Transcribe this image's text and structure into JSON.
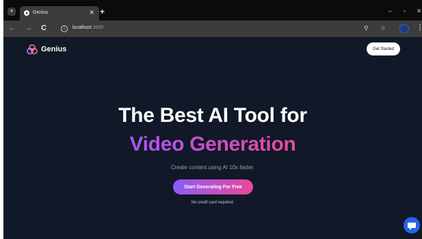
{
  "browser": {
    "tab_search_glyph": "▾",
    "tab": {
      "favicon_glyph": "▲",
      "title": "Genius",
      "close_glyph": "✕"
    },
    "new_tab_glyph": "+",
    "window": {
      "minimize": "–",
      "restore": "▫",
      "close": "✕"
    },
    "nav": {
      "back": "←",
      "forward": "→",
      "reload": "C"
    },
    "url": {
      "host": "localhost",
      "port": ":3000"
    },
    "info_glyph": "i",
    "zoom_glyph": "⚲",
    "bookmark_glyph": "☆",
    "menu_glyph": "⋮"
  },
  "header": {
    "brand": "Genius",
    "get_started_label": "Get Started"
  },
  "hero": {
    "headline_line1": "The Best AI Tool for",
    "headline_line2": "Video Generation",
    "subtitle": "Create content using AI 10x faster.",
    "cta_label": "Start Generating For Free",
    "note": "No credit card required."
  },
  "colors": {
    "page_bg": "#111827",
    "gradient_start": "#a855f7",
    "gradient_end": "#ec4899",
    "chat_bubble": "#2563eb"
  },
  "icons": {
    "logo": "genius-logo-icon",
    "chat": "chat-bubble-icon",
    "zoom": "zoom-icon",
    "bookmark": "star-icon",
    "profile": "profile-avatar"
  }
}
